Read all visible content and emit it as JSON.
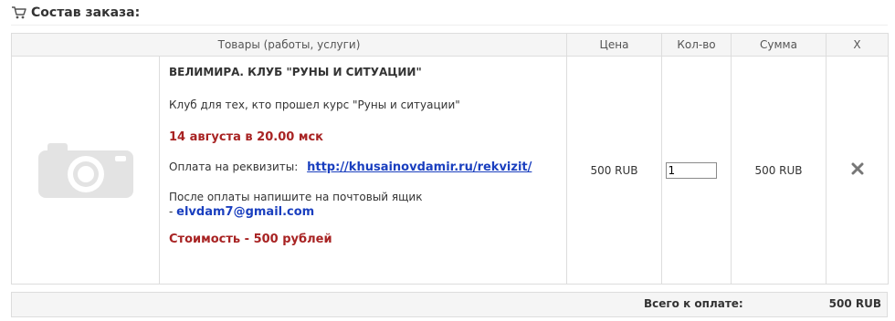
{
  "section": {
    "title": "Состав заказа:",
    "icon": "cart-icon"
  },
  "table": {
    "headers": {
      "product": "Товары (работы, услуги)",
      "price": "Цена",
      "qty": "Кол-во",
      "sum": "Сумма",
      "remove": "X"
    },
    "item": {
      "image_icon": "camera-placeholder-icon",
      "title": "ВЕЛИМИРА. КЛУБ \"РУНЫ И СИТУАЦИИ\"",
      "subtitle": "Клуб для тех, кто прошел курс \"Руны и ситуации\"",
      "date": "14 августа в 20.00 мск",
      "payment_label": "Оплата на реквизиты:",
      "payment_link": "http://khusainovdamir.ru/rekvizit/",
      "after_payment": "После оплаты напишите на почтовый ящик",
      "email_prefix": "- ",
      "email": "elvdam7@gmail.com",
      "cost": "Стоимость - 500 рублей",
      "price": "500 RUB",
      "quantity": "1",
      "sum": "500 RUB",
      "remove_icon": "close-icon"
    }
  },
  "total": {
    "label": "Всего к оплате:",
    "value": "500 RUB"
  },
  "colors": {
    "accent_red": "#a82323",
    "link_blue": "#1a3fbf",
    "header_bg": "#f5f5f5",
    "border": "#dddddd"
  }
}
